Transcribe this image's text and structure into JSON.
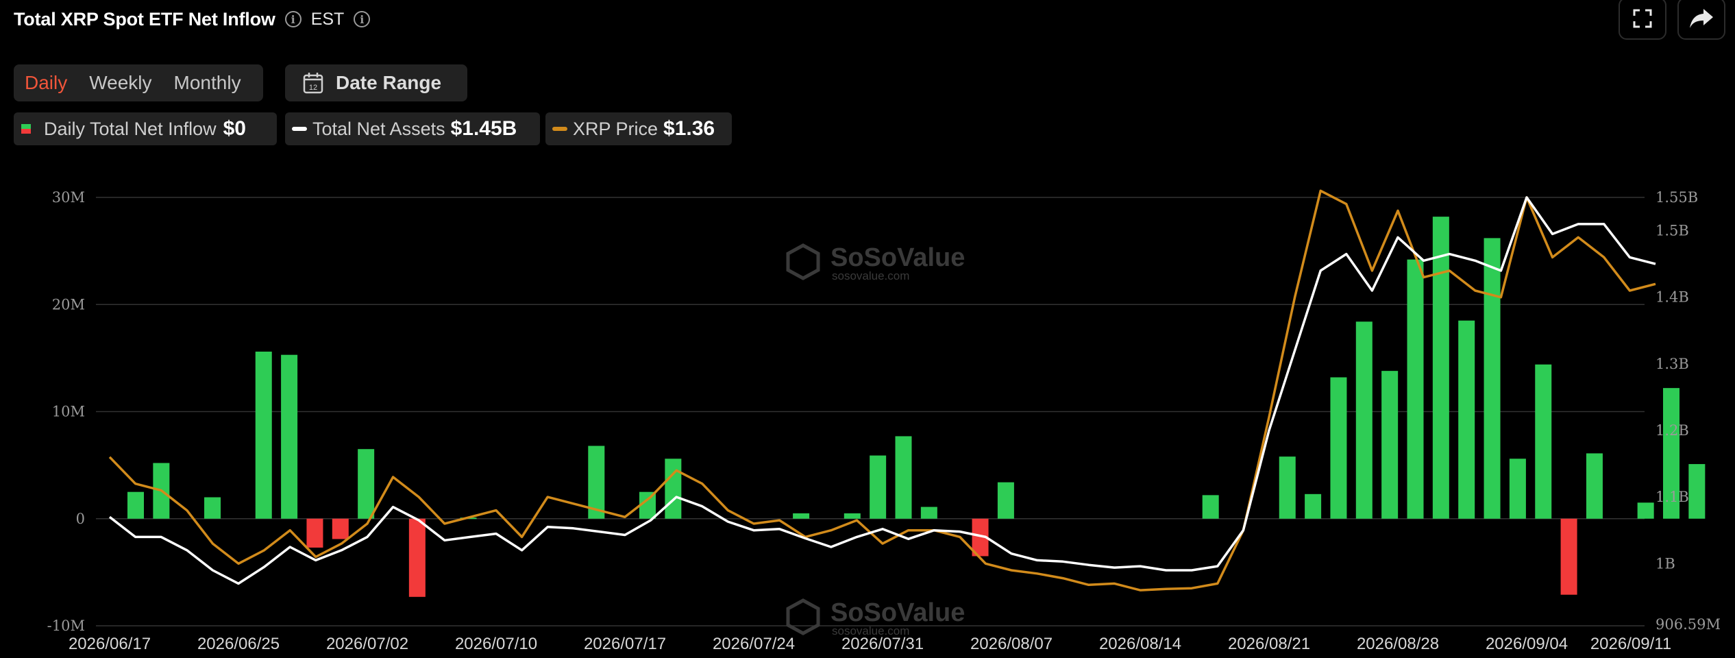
{
  "header": {
    "title": "Total XRP Spot ETF Net Inflow",
    "timezone": "EST"
  },
  "tabs": [
    "Daily",
    "Weekly",
    "Monthly"
  ],
  "active_tab": "Daily",
  "date_range_label": "Date Range",
  "calendar_icon_text": "12",
  "legend": [
    {
      "name": "Daily Total Net Inflow",
      "value": "$0"
    },
    {
      "name": "Total Net Assets",
      "value": "$1.45B"
    },
    {
      "name": "XRP Price",
      "value": "$1.36"
    }
  ],
  "watermark": {
    "brand": "SoSoValue",
    "site": "sosovalue.com"
  },
  "colors": {
    "positive": "#2ecc55",
    "negative": "#f23a3a",
    "assets_line": "#ffffff",
    "price_line": "#d28b1b",
    "grid": "#333333"
  },
  "chart_data": {
    "type": "bar",
    "x_tick_labels": [
      "2026/06/17",
      "2026/06/25",
      "2026/07/02",
      "2026/07/10",
      "2026/07/17",
      "2026/07/24",
      "2026/07/31",
      "2026/08/07",
      "2026/08/14",
      "2026/08/21",
      "2026/08/28",
      "2026/09/04",
      "2026/09/11"
    ],
    "y_left_ticks": [
      "30M",
      "20M",
      "10M",
      "0",
      "-10M"
    ],
    "y_left_range": [
      -10,
      30
    ],
    "y_right_ticks": [
      "1.55B",
      "1.5B",
      "1.4B",
      "1.3B",
      "1.2B",
      "1.1B",
      "1B",
      "906.59M"
    ],
    "y_right_range": [
      0.90659,
      1.55
    ],
    "series": [
      {
        "name": "Daily Total Net Inflow",
        "unit": "M USD",
        "values": [
          2.5,
          5.2,
          0,
          2,
          0,
          15.6,
          15.3,
          -2.7,
          -1.9,
          6.5,
          0,
          -7.3,
          0,
          0.1,
          0,
          0,
          0,
          0,
          6.8,
          0,
          2.5,
          5.6,
          0,
          0,
          0,
          0,
          0.5,
          0,
          0.5,
          5.9,
          7.7,
          1.1,
          0,
          -3.5,
          3.4,
          0,
          0,
          0,
          0,
          0,
          0,
          0,
          2.2,
          0,
          0,
          5.8,
          2.3,
          13.2,
          18.4,
          13.8,
          24.2,
          28.2,
          18.5,
          26.2,
          5.6,
          14.4,
          -7.1,
          6.1,
          0,
          1.5,
          12.2,
          5.1
        ]
      },
      {
        "name": "Total Net Assets",
        "unit": "B USD",
        "values": [
          1.07,
          1.04,
          1.04,
          1.02,
          0.99,
          0.97,
          0.995,
          1.025,
          1.005,
          1.02,
          1.04,
          1.085,
          1.065,
          1.035,
          1.04,
          1.045,
          1.02,
          1.055,
          1.053,
          1.048,
          1.043,
          1.065,
          1.1,
          1.086,
          1.063,
          1.05,
          1.052,
          1.038,
          1.025,
          1.04,
          1.052,
          1.037,
          1.05,
          1.048,
          1.04,
          1.015,
          1.005,
          1.003,
          0.998,
          0.994,
          0.996,
          0.99,
          0.99,
          0.996,
          1.05,
          1.2,
          1.32,
          1.44,
          1.465,
          1.41,
          1.49,
          1.455,
          1.465,
          1.455,
          1.44,
          1.55,
          1.495,
          1.51,
          1.51,
          1.46,
          1.45
        ]
      },
      {
        "name": "XRP Price",
        "unit": "USD",
        "values": [
          1.16,
          1.12,
          1.11,
          1.08,
          1.03,
          1.0,
          1.02,
          1.05,
          1.01,
          1.03,
          1.06,
          1.13,
          1.1,
          1.06,
          1.07,
          1.08,
          1.04,
          1.1,
          1.09,
          1.08,
          1.07,
          1.1,
          1.14,
          1.12,
          1.08,
          1.06,
          1.065,
          1.04,
          1.05,
          1.065,
          1.03,
          1.05,
          1.05,
          1.04,
          1.0,
          0.99,
          0.985,
          0.978,
          0.968,
          0.97,
          0.96,
          0.962,
          0.963,
          0.97,
          1.05,
          1.22,
          1.4,
          1.56,
          1.54,
          1.44,
          1.53,
          1.43,
          1.44,
          1.41,
          1.4,
          1.55,
          1.46,
          1.49,
          1.46,
          1.41,
          1.42
        ]
      }
    ]
  }
}
